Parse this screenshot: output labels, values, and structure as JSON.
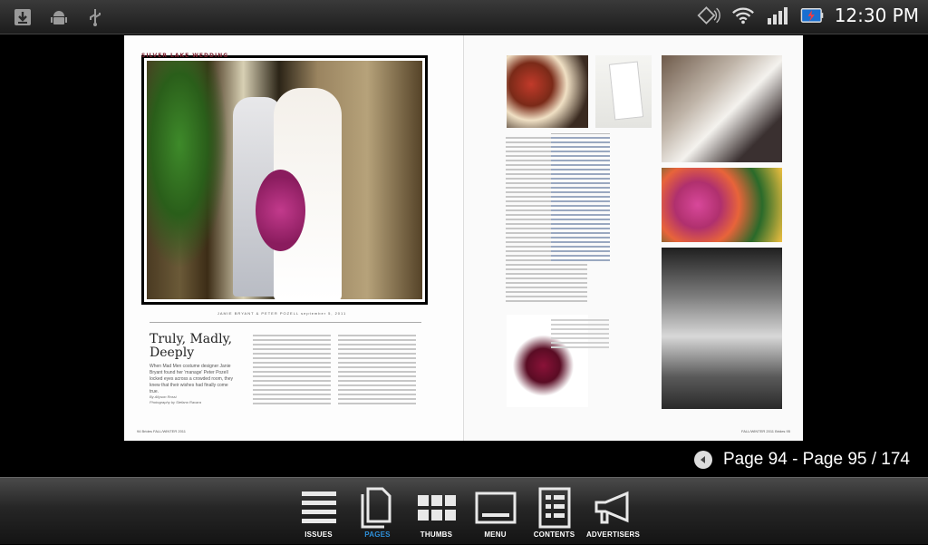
{
  "status_bar": {
    "time": "12:30 PM",
    "left_icons": [
      "download-icon",
      "android-debug-icon",
      "usb-icon"
    ],
    "right_icons": [
      "gps-icon",
      "wifi-icon",
      "signal-icon",
      "battery-charging-icon"
    ]
  },
  "magazine": {
    "section_label": "SILVER LAKE WEDDING",
    "credit_line": "JAMIE BRYANT & PETER POZELL  september 5, 2011",
    "headline": "Truly, Madly, Deeply",
    "dek": "When Mad Men costume designer Janie Bryant found her 'manage' Peter Pozell locked eyes across a crowded room, they knew that their wishes had finally come true.",
    "byline_1": "By Allyson Rossi",
    "byline_2": "Photography by Stefano Ravara",
    "folio_left": "94  Brides  FALL/WINTER 2011",
    "folio_right": "FALL/WINTER 2011  Brides  95"
  },
  "page_indicator": {
    "text": "Page 94 - Page 95 / 174"
  },
  "nav": {
    "items": [
      {
        "label": "ISSUES",
        "icon": "issues-icon"
      },
      {
        "label": "PAGES",
        "icon": "pages-icon"
      },
      {
        "label": "THUMBS",
        "icon": "thumbs-icon"
      },
      {
        "label": "MENU",
        "icon": "menu-icon"
      },
      {
        "label": "CONTENTS",
        "icon": "contents-icon"
      },
      {
        "label": "ADVERTISERS",
        "icon": "advertisers-icon"
      }
    ],
    "active_index": 1,
    "active_color": "#2e8fd8"
  }
}
